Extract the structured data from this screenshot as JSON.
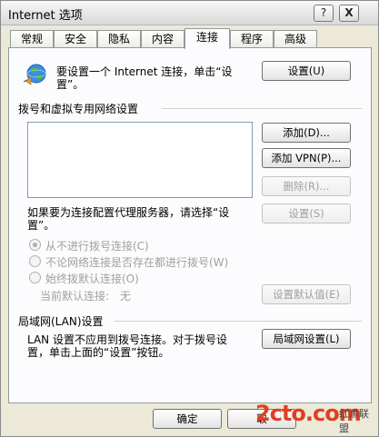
{
  "window": {
    "title": "Internet 选项",
    "help_glyph": "?",
    "close_glyph": "X"
  },
  "tabs": [
    {
      "label": "常规"
    },
    {
      "label": "安全"
    },
    {
      "label": "隐私"
    },
    {
      "label": "内容"
    },
    {
      "label": "连接"
    },
    {
      "label": "程序"
    },
    {
      "label": "高级"
    }
  ],
  "active_tab": "连接",
  "connection": {
    "setup_text_line1": "要设置一个 Internet 连接，单击“设",
    "setup_text_line2": "置”。",
    "setup_button": "设置(U)",
    "dialup_group": "拨号和虚拟专用网络设置",
    "add_button": "添加(D)...",
    "add_vpn_button": "添加 VPN(P)...",
    "remove_button": "删除(R)...",
    "proxy_text_line1": "如果要为连接配置代理服务器，请选择“设",
    "proxy_text_line2": "置”。",
    "settings_button": "设置(S)",
    "radio_never": "从不进行拨号连接(C)",
    "radio_whenever": "不论网络连接是否存在都进行拨号(W)",
    "radio_always": "始终拨默认连接(O)",
    "current_default_label": "当前默认连接:",
    "current_default_value": "无",
    "set_default_button": "设置默认值(E)",
    "lan_group": "局域网(LAN)设置",
    "lan_text_line1": "LAN 设置不应用到拨号连接。对于拨号设",
    "lan_text_line2": "置，单击上面的“设置”按钮。",
    "lan_button": "局域网设置(L)"
  },
  "footer": {
    "ok_button": "确定",
    "cancel_button": "取"
  },
  "watermark": {
    "text": "2cto.com",
    "side_text": "红黑联盟"
  },
  "colors": {
    "dialog_bg": "#ece9d8",
    "panel_bg": "#fcfcfe",
    "disabled_text": "#a0a0a0"
  },
  "icons": {
    "connection": "globe-network-icon"
  }
}
